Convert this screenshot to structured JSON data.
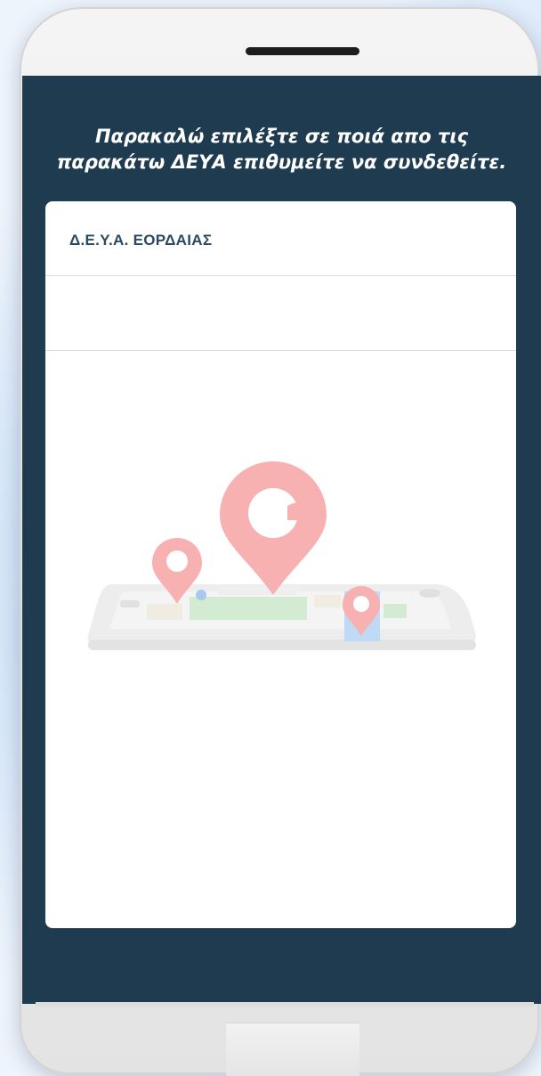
{
  "prompt": {
    "line1": "Παρακαλώ επιλέξτε σε ποιά απο τις",
    "line2": "παρακάτω ΔΕΥΑ επιθυμείτε να συνδεθείτε."
  },
  "providers": [
    {
      "label": "Δ.Ε.Υ.Α. ΕΟΡΔΑΙΑΣ"
    },
    {
      "label": ""
    }
  ],
  "illustration": {
    "icon": "map-location-pins-illustration",
    "pin_color": "#f7a9a8",
    "map_green": "#cfe8cf",
    "map_blue": "#b7d6f3"
  },
  "theme": {
    "screen_bg": "#1e3b50",
    "card_bg": "#ffffff",
    "label_color": "#2b4a62"
  }
}
